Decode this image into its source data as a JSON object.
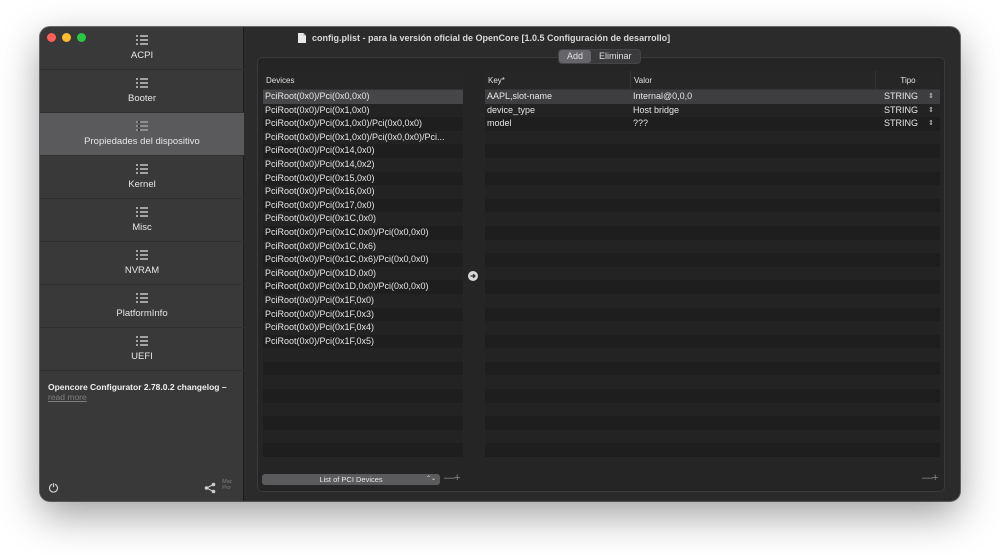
{
  "window": {
    "title": "config.plist - para la versión oficial de OpenCore [1.0.5 Configuración de desarrollo]"
  },
  "sidebar": {
    "items": [
      {
        "label": "ACPI",
        "selected": false
      },
      {
        "label": "Booter",
        "selected": false
      },
      {
        "label": "Propiedades del dispositivo",
        "selected": true
      },
      {
        "label": "Kernel",
        "selected": false
      },
      {
        "label": "Misc",
        "selected": false
      },
      {
        "label": "NVRAM",
        "selected": false
      },
      {
        "label": "PlatformInfo",
        "selected": false
      },
      {
        "label": "UEFI",
        "selected": false
      }
    ],
    "changelog_title": "Opencore Configurator 2.78.0.2 changelog –",
    "changelog_link": "read more",
    "brand_line1": "Mac",
    "brand_line2": "Pro"
  },
  "segment": {
    "add_label": "Add",
    "delete_label": "Eliminar"
  },
  "devices": {
    "header": "Devices",
    "rows": [
      "PciRoot(0x0)/Pci(0x0,0x0)",
      "PciRoot(0x0)/Pci(0x1,0x0)",
      "PciRoot(0x0)/Pci(0x1,0x0)/Pci(0x0,0x0)",
      "PciRoot(0x0)/Pci(0x1,0x0)/Pci(0x0,0x0)/Pci...",
      "PciRoot(0x0)/Pci(0x14,0x0)",
      "PciRoot(0x0)/Pci(0x14,0x2)",
      "PciRoot(0x0)/Pci(0x15,0x0)",
      "PciRoot(0x0)/Pci(0x16,0x0)",
      "PciRoot(0x0)/Pci(0x17,0x0)",
      "PciRoot(0x0)/Pci(0x1C,0x0)",
      "PciRoot(0x0)/Pci(0x1C,0x0)/Pci(0x0,0x0)",
      "PciRoot(0x0)/Pci(0x1C,0x6)",
      "PciRoot(0x0)/Pci(0x1C,0x6)/Pci(0x0,0x0)",
      "PciRoot(0x0)/Pci(0x1D,0x0)",
      "PciRoot(0x0)/Pci(0x1D,0x0)/Pci(0x0,0x0)",
      "PciRoot(0x0)/Pci(0x1F,0x0)",
      "PciRoot(0x0)/Pci(0x1F,0x3)",
      "PciRoot(0x0)/Pci(0x1F,0x4)",
      "PciRoot(0x0)/Pci(0x1F,0x5)"
    ],
    "selected_index": 0,
    "popup_label": "List of PCI Devices"
  },
  "properties": {
    "headers": {
      "key": "Key*",
      "value": "Valor",
      "type": "Tipo"
    },
    "rows": [
      {
        "key": "AAPL,slot-name",
        "value": "Internal@0,0,0",
        "type": "STRING"
      },
      {
        "key": "device_type",
        "value": "Host bridge",
        "type": "STRING"
      },
      {
        "key": "model",
        "value": "???",
        "type": "STRING"
      }
    ]
  },
  "controls": {
    "minus": "—",
    "plus": "+"
  },
  "colors": {
    "close": "#ff5f57",
    "minimize": "#febc2e",
    "maximize": "#28c840",
    "sidebar_bg": "#39393a",
    "selected_item": "#5a5a5c"
  }
}
